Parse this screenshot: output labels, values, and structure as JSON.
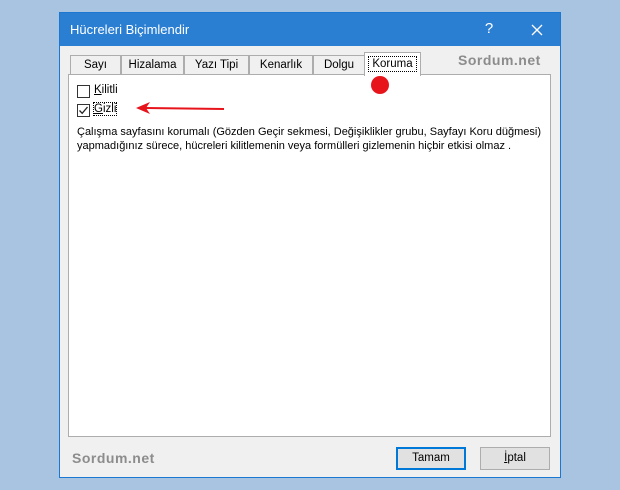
{
  "window": {
    "title": "Hücreleri Biçimlendir",
    "help_label": "?",
    "close_label": "✕"
  },
  "tabs": [
    {
      "label": "Sayı"
    },
    {
      "label": "Hizalama"
    },
    {
      "label": "Yazı Tipi"
    },
    {
      "label": "Kenarlık"
    },
    {
      "label": "Dolgu"
    },
    {
      "label": "Koruma",
      "active": true
    }
  ],
  "watermarks": {
    "top": "Sordum.net",
    "bottom": "Sordum.net"
  },
  "protection": {
    "locked": {
      "label_first": "K",
      "label_rest": "ilitli",
      "checked": false
    },
    "hidden": {
      "label_first": "G",
      "label_rest": "izli",
      "checked": true
    },
    "description": "Çalışma sayfasını korumalı (Gözden Geçir sekmesi, Değişiklikler grubu, Sayfayı Koru düğmesi) yapmadığınız sürece, hücreleri kilitlemenin veya formülleri gizlemenin hiçbir etkisi olmaz ."
  },
  "buttons": {
    "ok": "Tamam",
    "cancel_first": "İ",
    "cancel_rest": "ptal"
  },
  "annotations": {
    "arrow_color": "#e8141c",
    "dot_color": "#e8141c"
  }
}
